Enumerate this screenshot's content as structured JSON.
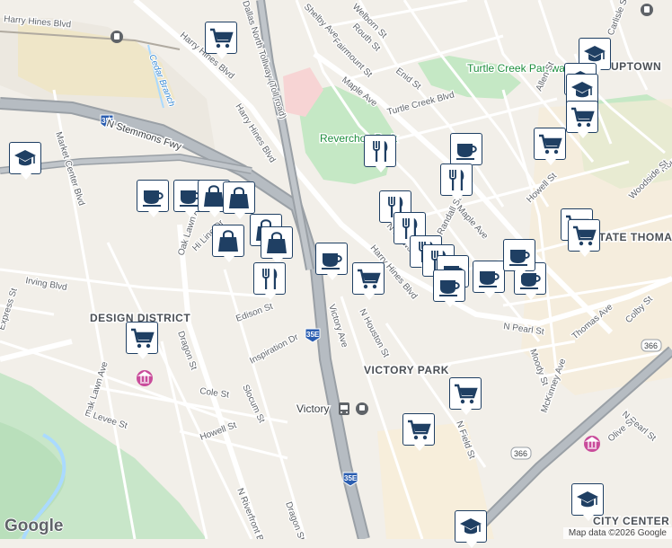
{
  "map": {
    "attribution": "Map data ©2026 Google",
    "logo": "Google",
    "colors": {
      "land": "#f2efe9",
      "park": "#c5e8c5",
      "water": "#aadaff",
      "freeway": "#9aa0a6",
      "downtown": "#f7edd7",
      "marker_border": "#1f3f63",
      "marker_icon": "#1f3f63"
    },
    "area_labels": [
      "DESIGN DISTRICT",
      "VICTORY PARK",
      "UPTOWN",
      "STATE THOMAS",
      "CITY CENTER DISTRICT"
    ],
    "park_labels": [
      "Turtle Creek Parkway Park",
      "Reverchon Park"
    ],
    "water_labels": [
      "Cedar Branch"
    ],
    "poi_labels": [
      "Victory"
    ],
    "highway_shields": [
      "35E",
      "35E",
      "35E",
      "366",
      "366"
    ],
    "street_labels": [
      "Harry Hines Blvd",
      "Harry Hines Blvd",
      "Harry Hines Blvd",
      "Harry Hines Blvd",
      "Dallas North Tollway (Toll road)",
      "N Stemmons Fwy",
      "Market Center Blvd",
      "Oak Lawn Ave",
      "Oak Lawn Ave",
      "Irving Blvd",
      "Express St",
      "Dragon St",
      "Dragon St",
      "Cole St",
      "Slocum St",
      "Howell St",
      "E Levee St",
      "N Riverfront Blvd",
      "Inspiration Dr",
      "Edison St",
      "Victory Ave",
      "N Houston St",
      "Maple Ave",
      "Maple Ave",
      "Fairmount St",
      "Routh St",
      "Routh St",
      "Welborn St",
      "Shelby Ave",
      "Enid St",
      "Turtle Creek Blvd",
      "Allen St",
      "N Harwood St",
      "Randall St",
      "N Pearl St",
      "N Pearl St",
      "McKinney Ave",
      "Thomas Ave",
      "Colby St",
      "Howell St",
      "Olive St",
      "N Field St",
      "Woodside St",
      "Carlisle St",
      "Moody St",
      "Hi Line Dr"
    ],
    "markers": [
      {
        "name": "education-marker",
        "icon": "education-icon"
      },
      {
        "name": "shopping-marker",
        "icon": "shopping-cart-icon"
      },
      {
        "name": "education-marker",
        "icon": "education-icon"
      },
      {
        "name": "cafe-marker",
        "icon": "coffee-cup-icon"
      },
      {
        "name": "cafe-marker",
        "icon": "coffee-cup-icon"
      },
      {
        "name": "store-marker",
        "icon": "shopping-bag-icon"
      },
      {
        "name": "store-marker",
        "icon": "shopping-bag-icon"
      },
      {
        "name": "store-marker",
        "icon": "shopping-bag-icon"
      },
      {
        "name": "store-marker",
        "icon": "shopping-bag-icon"
      },
      {
        "name": "store-marker",
        "icon": "shopping-bag-icon"
      },
      {
        "name": "restaurant-marker",
        "icon": "fork-knife-icon"
      },
      {
        "name": "cafe-marker",
        "icon": "coffee-cup-icon"
      },
      {
        "name": "shopping-marker",
        "icon": "shopping-cart-icon"
      },
      {
        "name": "restaurant-marker",
        "icon": "fork-knife-icon"
      },
      {
        "name": "cafe-marker",
        "icon": "coffee-cup-icon"
      },
      {
        "name": "restaurant-marker",
        "icon": "fork-knife-icon"
      },
      {
        "name": "restaurant-marker",
        "icon": "fork-knife-icon"
      },
      {
        "name": "restaurant-marker",
        "icon": "fork-knife-icon"
      },
      {
        "name": "restaurant-marker",
        "icon": "fork-knife-icon"
      },
      {
        "name": "restaurant-marker",
        "icon": "fork-knife-icon"
      },
      {
        "name": "cafe-marker",
        "icon": "coffee-cup-icon"
      },
      {
        "name": "cafe-marker",
        "icon": "coffee-cup-icon"
      },
      {
        "name": "cafe-marker",
        "icon": "coffee-cup-icon"
      },
      {
        "name": "cafe-marker",
        "icon": "coffee-cup-icon"
      },
      {
        "name": "shopping-marker",
        "icon": "shopping-cart-icon"
      },
      {
        "name": "shopping-marker",
        "icon": "shopping-cart-icon"
      },
      {
        "name": "shopping-marker",
        "icon": "shopping-cart-icon"
      },
      {
        "name": "education-marker",
        "icon": "education-icon"
      },
      {
        "name": "education-marker",
        "icon": "education-icon"
      },
      {
        "name": "shopping-marker",
        "icon": "shopping-cart-icon"
      },
      {
        "name": "shopping-marker",
        "icon": "shopping-cart-icon"
      },
      {
        "name": "shopping-marker",
        "icon": "shopping-cart-icon"
      },
      {
        "name": "cafe-marker",
        "icon": "coffee-cup-icon"
      },
      {
        "name": "shopping-marker",
        "icon": "shopping-cart-icon"
      },
      {
        "name": "education-marker",
        "icon": "education-icon"
      },
      {
        "name": "education-marker",
        "icon": "education-icon"
      }
    ]
  }
}
